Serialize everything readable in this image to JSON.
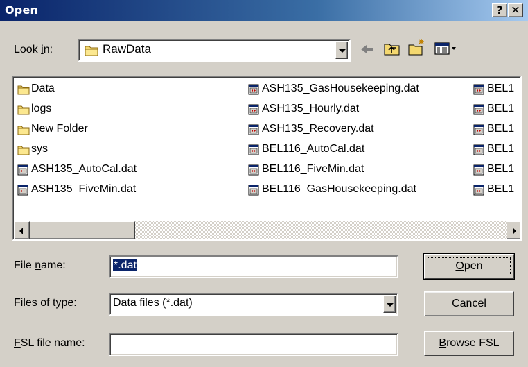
{
  "window": {
    "title": "Open",
    "help_label": "?",
    "close_label": "✕"
  },
  "look_in": {
    "label_pre": "Look ",
    "label_u": "i",
    "label_post": "n:",
    "value": "RawData"
  },
  "toolbar": {
    "back_icon": "back-arrow-icon",
    "up_icon": "up-folder-icon",
    "new_folder_icon": "new-folder-icon",
    "view_icon": "view-menu-icon"
  },
  "file_list": {
    "col1": [
      {
        "name": "Data",
        "type": "folder"
      },
      {
        "name": "logs",
        "type": "folder"
      },
      {
        "name": "New Folder",
        "type": "folder"
      },
      {
        "name": "sys",
        "type": "folder"
      },
      {
        "name": "ASH135_AutoCal.dat",
        "type": "file"
      },
      {
        "name": "ASH135_FiveMin.dat",
        "type": "file"
      }
    ],
    "col2": [
      {
        "name": "ASH135_GasHousekeeping.dat",
        "type": "file"
      },
      {
        "name": "ASH135_Hourly.dat",
        "type": "file"
      },
      {
        "name": "ASH135_Recovery.dat",
        "type": "file"
      },
      {
        "name": "BEL116_AutoCal.dat",
        "type": "file"
      },
      {
        "name": "BEL116_FiveMin.dat",
        "type": "file"
      },
      {
        "name": "BEL116_GasHousekeeping.dat",
        "type": "file"
      }
    ],
    "col3": [
      {
        "name": "BEL1",
        "type": "file"
      },
      {
        "name": "BEL1",
        "type": "file"
      },
      {
        "name": "BEL1",
        "type": "file"
      },
      {
        "name": "BEL1",
        "type": "file"
      },
      {
        "name": "BEL1",
        "type": "file"
      },
      {
        "name": "BEL1",
        "type": "file"
      }
    ]
  },
  "file_name": {
    "label_pre": "File ",
    "label_u": "n",
    "label_post": "ame:",
    "value": "*.dat"
  },
  "files_of_type": {
    "label_pre": "Files of ",
    "label_u": "t",
    "label_post": "ype:",
    "value": "Data files (*.dat)"
  },
  "fsl_file_name": {
    "label_pre": "",
    "label_u": "F",
    "label_post": "SL file name:",
    "value": ""
  },
  "buttons": {
    "open_u": "O",
    "open_rest": "pen",
    "cancel": "Cancel",
    "browse_u": "B",
    "browse_rest": "rowse FSL"
  },
  "colors": {
    "title_start": "#0a246a",
    "title_end": "#a6caf0",
    "face": "#d4d0c8",
    "selection": "#0a246a"
  }
}
